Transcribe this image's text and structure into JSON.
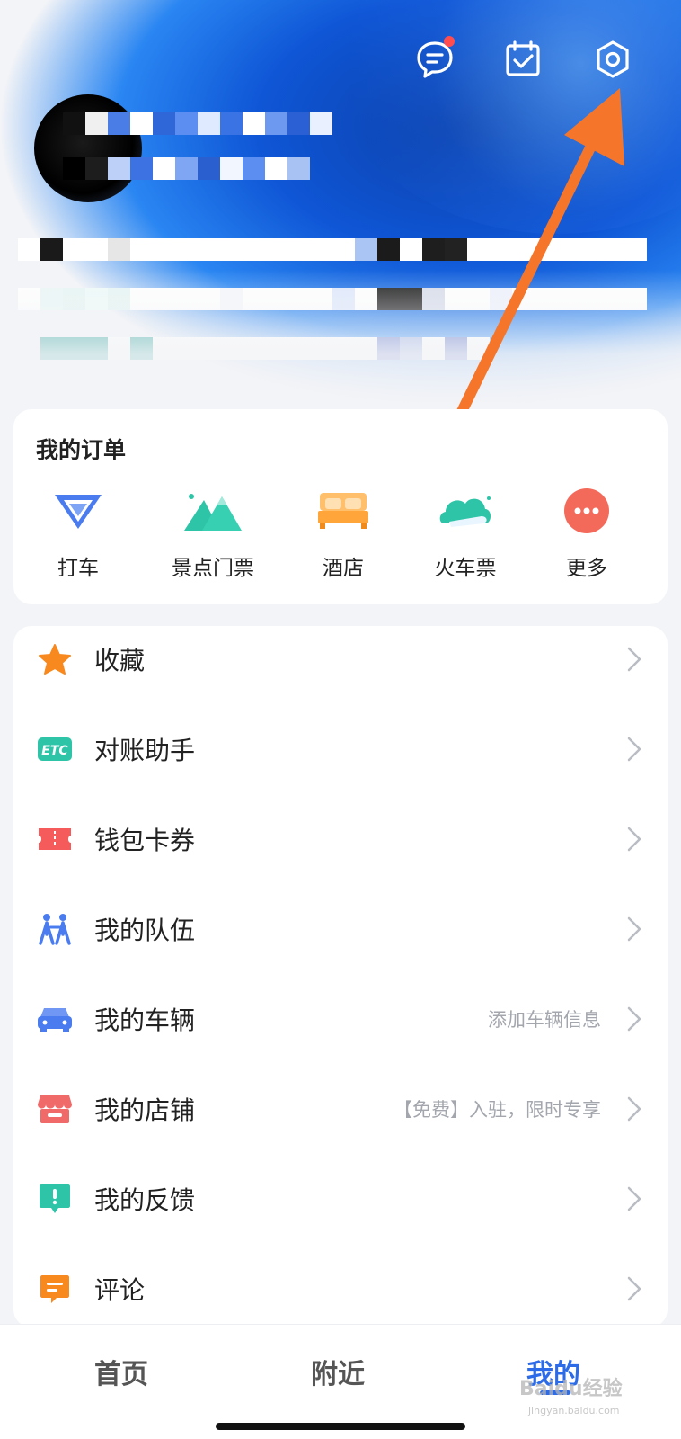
{
  "header": {
    "message_has_badge": true,
    "icons": [
      "message-icon",
      "checkin-icon",
      "settings-icon"
    ]
  },
  "orders": {
    "title": "我的订单",
    "items": [
      {
        "label": "打车",
        "icon": "taxi-icon"
      },
      {
        "label": "景点门票",
        "icon": "scenic-ticket-icon"
      },
      {
        "label": "酒店",
        "icon": "hotel-icon"
      },
      {
        "label": "火车票",
        "icon": "train-ticket-icon"
      },
      {
        "label": "更多",
        "icon": "more-icon"
      }
    ]
  },
  "menu": {
    "items": [
      {
        "label": "收藏",
        "hint": "",
        "icon": "star-icon"
      },
      {
        "label": "对账助手",
        "hint": "",
        "icon": "etc-icon"
      },
      {
        "label": "钱包卡券",
        "hint": "",
        "icon": "coupon-icon"
      },
      {
        "label": "我的队伍",
        "hint": "",
        "icon": "team-icon"
      },
      {
        "label": "我的车辆",
        "hint": "添加车辆信息",
        "icon": "car-icon"
      },
      {
        "label": "我的店铺",
        "hint": "【免费】入驻，限时专享",
        "icon": "shop-icon"
      },
      {
        "label": "我的反馈",
        "hint": "",
        "icon": "feedback-icon"
      },
      {
        "label": "评论",
        "hint": "",
        "icon": "comment-icon"
      }
    ]
  },
  "tabs": [
    {
      "label": "首页",
      "active": false
    },
    {
      "label": "附近",
      "active": false
    },
    {
      "label": "我的",
      "active": true
    }
  ],
  "watermark": {
    "text": "Baidu经验",
    "sub": "jingyan.baidu.com"
  },
  "colors": {
    "accent": "#2d6ce8",
    "star": "#f7891f",
    "etc": "#2ec4a8",
    "coupon": "#f55b5b",
    "team": "#4a7cf0",
    "car": "#4a7cf0",
    "shop": "#f06a6a",
    "feedback": "#2ec4a8",
    "comment": "#f7891f",
    "arrow": "#f5762b"
  }
}
